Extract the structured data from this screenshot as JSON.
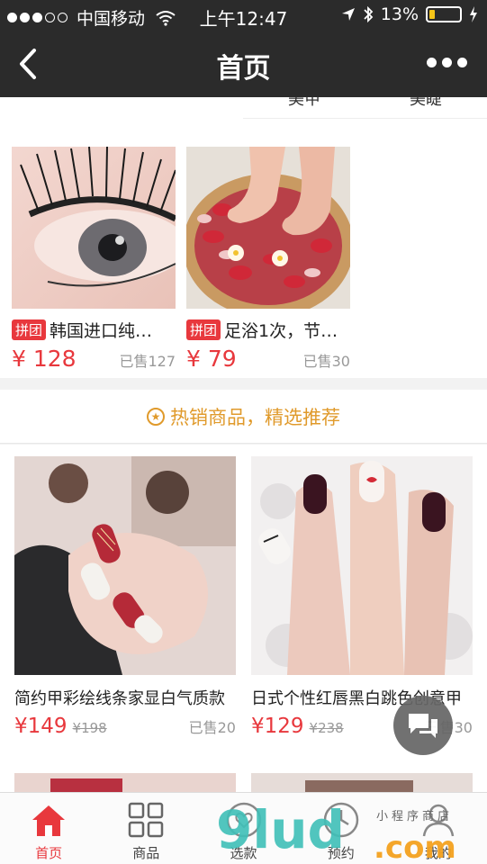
{
  "status_bar": {
    "carrier": "中国移动",
    "time": "上午12:47",
    "battery": "13%"
  },
  "nav": {
    "title": "首页"
  },
  "top_tabs": [
    "美甲",
    "美睫"
  ],
  "group_buys": [
    {
      "tag": "拼团",
      "name": "韩国进口纯…",
      "price": "¥ 128",
      "sold": "已售127"
    },
    {
      "tag": "拼团",
      "name": "足浴1次，节…",
      "price": "¥ 79",
      "sold": "已售30"
    }
  ],
  "hot_section": {
    "title": "热销商品，精选推荐"
  },
  "products": [
    {
      "name": "简约甲彩绘线条家显白气质款",
      "price": "¥149",
      "original_price": "¥198",
      "sold": "已售20"
    },
    {
      "name": "日式个性红唇黑白跳色创意甲",
      "price": "¥129",
      "original_price": "¥238",
      "sold": "已售30"
    }
  ],
  "tabbar": [
    {
      "label": "首页",
      "icon": "home-icon",
      "active": true
    },
    {
      "label": "商品",
      "icon": "grid-icon",
      "active": false
    },
    {
      "label": "选款",
      "icon": "heart-icon",
      "active": false
    },
    {
      "label": "预约",
      "icon": "clock-icon",
      "active": false
    },
    {
      "label": "我的",
      "icon": "user-icon",
      "active": false
    }
  ],
  "watermark": {
    "main": "9lud",
    "com": ".com",
    "small": "小程序商店"
  },
  "colors": {
    "accent": "#e8383d",
    "hot": "#e09a2b",
    "navbar": "#2b2b2b"
  }
}
